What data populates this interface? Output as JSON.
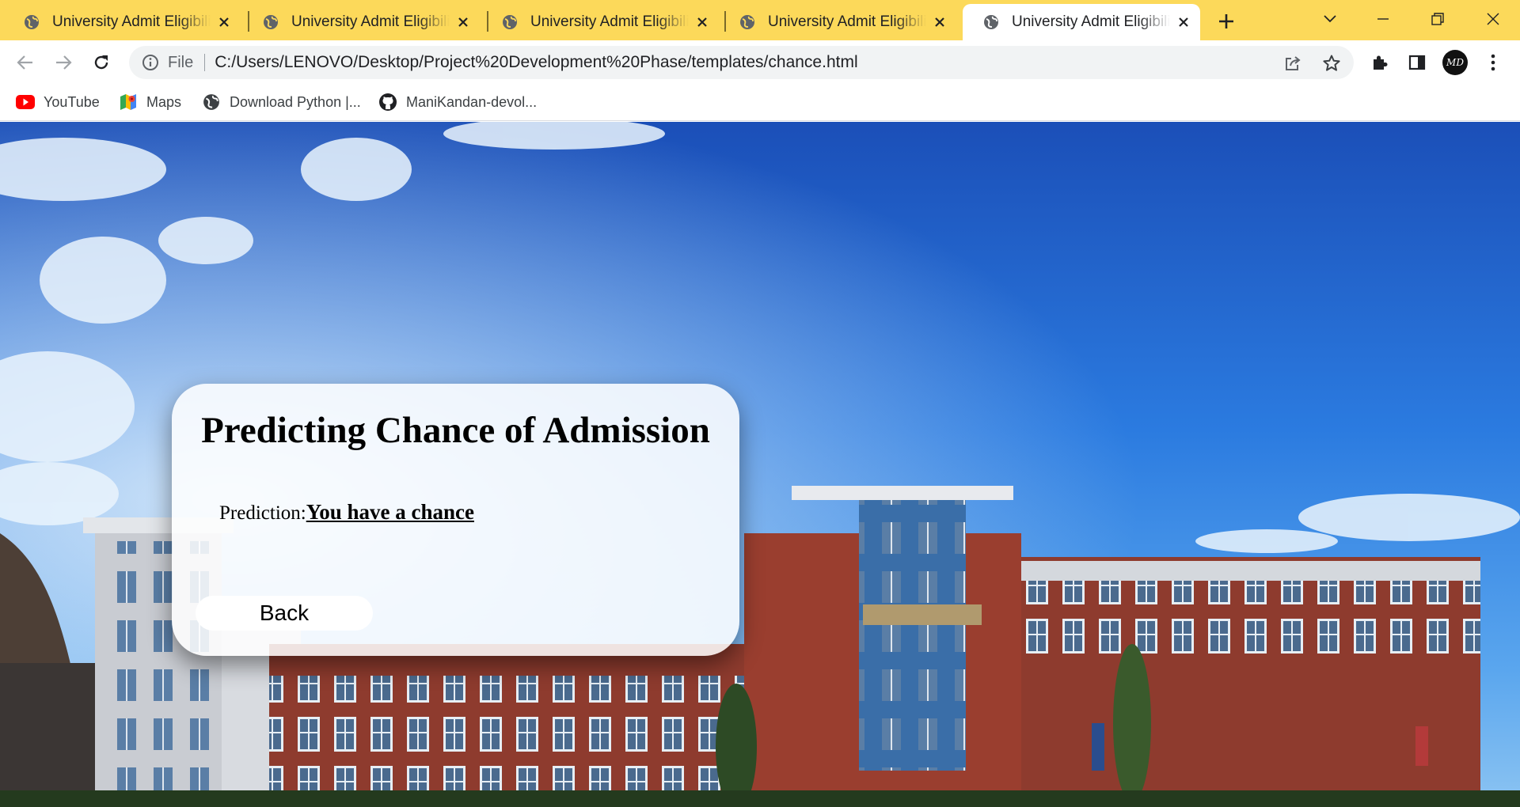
{
  "browser": {
    "tabs": [
      {
        "title": "University Admit Eligibility Predictor",
        "active": false
      },
      {
        "title": "University Admit Eligibility Predictor",
        "active": false
      },
      {
        "title": "University Admit Eligibility Predictor",
        "active": false
      },
      {
        "title": "University Admit Eligibility Predictor",
        "active": false
      },
      {
        "title": "University Admit Eligibility Predictor",
        "active": true
      }
    ],
    "tab_icon": "globe-icon",
    "address": {
      "scheme_label": "File",
      "url": "C:/Users/LENOVO/Desktop/Project%20Development%20Phase/templates/chance.html"
    },
    "bookmarks": [
      {
        "label": "YouTube",
        "icon": "youtube-icon"
      },
      {
        "label": "Maps",
        "icon": "maps-icon"
      },
      {
        "label": "Download Python |...",
        "icon": "globe-icon"
      },
      {
        "label": "ManiKandan-devol...",
        "icon": "github-icon"
      }
    ],
    "profile_initials": "MD",
    "colors": {
      "tabstrip": "#fcd95a",
      "omnibox": "#f1f3f4"
    }
  },
  "page": {
    "title": "Predicting Chance of Admission",
    "prediction_label": "Prediction:",
    "prediction_value": "You have a chance",
    "back_label": "Back"
  }
}
